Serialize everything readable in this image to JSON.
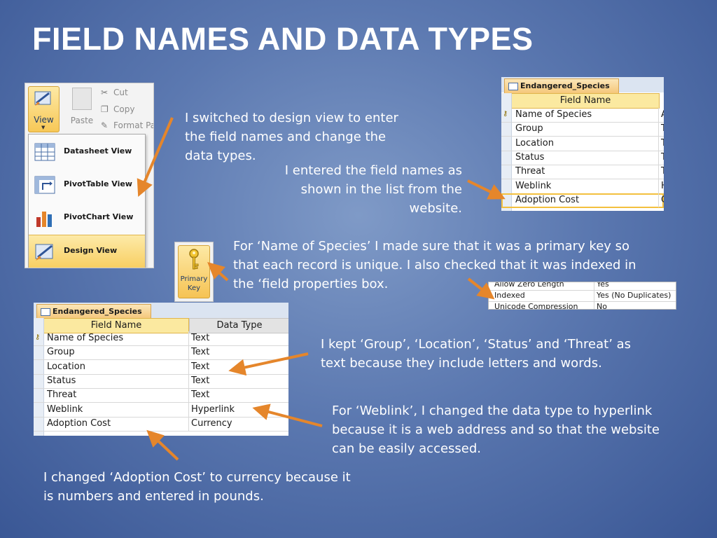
{
  "slide": {
    "title": "FIELD NAMES AND DATA TYPES"
  },
  "captions": {
    "design_view": [
      "I switched to design view to enter",
      "the field names and change the",
      "data types."
    ],
    "field_names": [
      "I entered the field names as",
      "shown in the list from the",
      "website."
    ],
    "primary_key": [
      "For ‘Name of Species’ I made sure that it was a primary key so",
      "that each record is unique. I also checked that it was indexed in",
      "the ‘field properties box."
    ],
    "text_fields": [
      "I kept ‘Group’, ‘Location’, ‘Status’ and ‘Threat’ as",
      "text because they include letters and words."
    ],
    "weblink": [
      "For ‘Weblink’, I changed the data type to hyperlink",
      "because it is a web address and so that the website",
      "can be easily accessed."
    ],
    "adoption_cost": [
      "I changed ‘Adoption Cost’ to currency because it",
      "is numbers and entered in pounds."
    ]
  },
  "ribbon": {
    "view_label": "View",
    "paste_label": "Paste",
    "cut_label": "Cut",
    "copy_label": "Copy",
    "format_label": "Format Pa",
    "menu": [
      {
        "label": "Datasheet View",
        "icon": "datasheet-icon"
      },
      {
        "label": "PivotTable View",
        "icon": "pivottable-icon"
      },
      {
        "label": "PivotChart View",
        "icon": "pivotchart-icon"
      },
      {
        "label": "Design View",
        "icon": "design-view-icon"
      }
    ]
  },
  "primary_key_button": {
    "line1": "Primary",
    "line2": "Key"
  },
  "table_top": {
    "tab": "Endangered_Species",
    "header_field": "Field Name",
    "rows": [
      {
        "field": "Name of Species",
        "type": "A"
      },
      {
        "field": "Group",
        "type": "T"
      },
      {
        "field": "Location",
        "type": "T"
      },
      {
        "field": "Status",
        "type": "T"
      },
      {
        "field": "Threat",
        "type": "T"
      },
      {
        "field": "Weblink",
        "type": "H"
      },
      {
        "field": "Adoption Cost",
        "type": "C"
      }
    ]
  },
  "table_bottom": {
    "tab": "Endangered_Species",
    "header_field": "Field Name",
    "header_type": "Data Type",
    "rows": [
      {
        "field": "Name of Species",
        "type": "Text"
      },
      {
        "field": "Group",
        "type": "Text"
      },
      {
        "field": "Location",
        "type": "Text"
      },
      {
        "field": "Status",
        "type": "Text"
      },
      {
        "field": "Threat",
        "type": "Text"
      },
      {
        "field": "Weblink",
        "type": "Hyperlink"
      },
      {
        "field": "Adoption Cost",
        "type": "Currency"
      }
    ]
  },
  "field_properties": [
    {
      "key": "Allow Zero Length",
      "value": "Yes"
    },
    {
      "key": "Indexed",
      "value": "Yes (No Duplicates)"
    },
    {
      "key": "Unicode Compression",
      "value": "No"
    }
  ],
  "colors": {
    "arrow": "#e5862b",
    "selection_yellow": "#f8cf63",
    "header_yellow": "#fbe9a0"
  }
}
